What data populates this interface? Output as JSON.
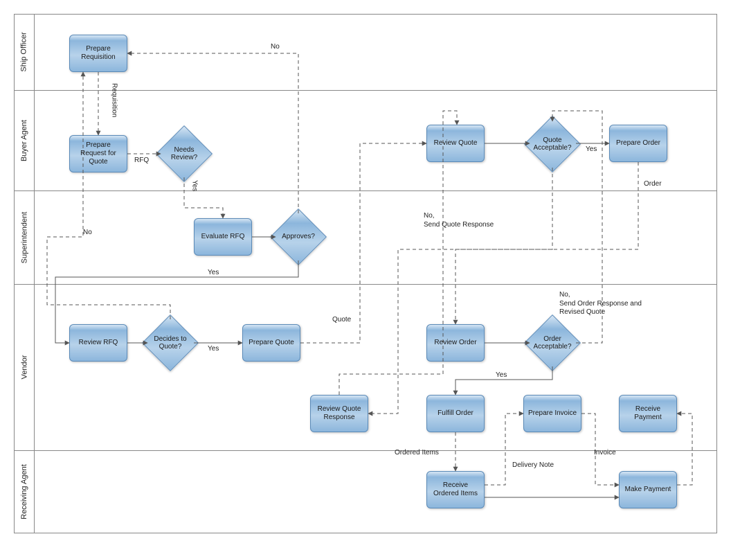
{
  "lanes": {
    "l1": "Ship Officer",
    "l2": "Buyer Agent",
    "l3": "Superintendent",
    "l4": "Vendor",
    "l5": "Receiving Agent"
  },
  "nodes": {
    "prepare_requisition": "Prepare Requisition",
    "prepare_rfq": "Prepare Request for Quote",
    "needs_review": "Needs Review?",
    "evaluate_rfq": "Evaluate RFQ",
    "approves": "Approves?",
    "review_rfq": "Review RFQ",
    "decides_quote": "Decides to Quote?",
    "prepare_quote": "Prepare Quote",
    "review_quote": "Review Quote",
    "quote_acceptable": "Quote Acceptable?",
    "prepare_order": "Prepare Order",
    "review_quote_response": "Review Quote Response",
    "review_order": "Review Order",
    "order_acceptable": "Order Acceptable?",
    "fulfill_order": "Fulfill Order",
    "prepare_invoice": "Prepare Invoice",
    "receive_payment": "Receive Payment",
    "receive_ordered_items": "Receive Ordered Items",
    "make_payment": "Make Payment"
  },
  "edge_labels": {
    "requisition_v": "Requisition",
    "rfq": "RFQ",
    "needs_review_yes": "Yes",
    "approves_no_top": "No",
    "approves_yes": "Yes",
    "decides_no": "No",
    "decides_yes": "Yes",
    "quote": "Quote",
    "quote_acc_yes": "Yes",
    "quote_acc_no": "No,\nSend Quote Response",
    "order": "Order",
    "order_acc_yes": "Yes",
    "order_acc_no": "No,\nSend Order Response and\nRevised Quote",
    "ordered_items": "Ordered Items",
    "delivery_note": "Delivery Note",
    "invoice": "Invoice"
  }
}
